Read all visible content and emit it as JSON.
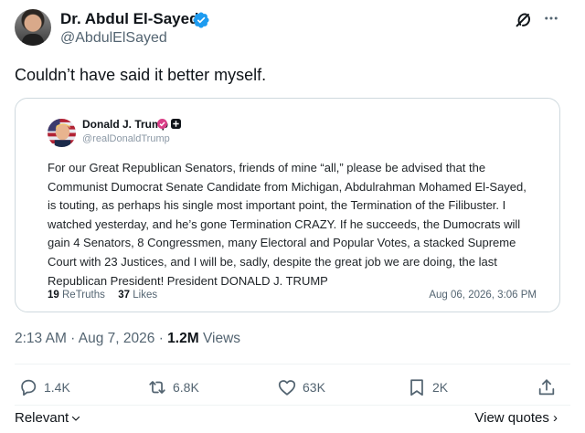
{
  "author": {
    "name": "Dr. Abdul El-Sayed",
    "handle": "@AbdulElSayed"
  },
  "tweet": {
    "text": "Couldn’t have said it better myself."
  },
  "quoted": {
    "name": "Donald J. Trump",
    "handle": "@realDonaldTrump",
    "body": "For our Great Republican Senators, friends of mine “all,” please be advised that the Communist Dumocrat Senate Candidate from Michigan, Abdulrahman Mohamed El-Sayed, is touting, as perhaps his single most important point, the Termination of the Filibuster. I watched yesterday, and he’s gone Termination CRAZY. If he succeeds, the Dumocrats will gain 4 Senators, 8 Congressmen, many Electoral and Popular Votes, a stacked Supreme Court with 23 Justices, and I will be, sadly, despite the great job we are doing, the last Republican President! President DONALD J. TRUMP",
    "retruths_count": "19",
    "retruths_label": "ReTruths",
    "likes_count": "37",
    "likes_label": "Likes",
    "date": "Aug 06, 2026, 3:06 PM"
  },
  "meta": {
    "time": "2:13 AM · Aug 7, 2026 ·",
    "views_count": "1.2M",
    "views_label": "Views"
  },
  "actions": {
    "replies": "1.4K",
    "reposts": "6.8K",
    "likes": "63K",
    "bookmarks": "2K"
  },
  "footer": {
    "sort_label": "Relevant",
    "view_quotes": "View quotes ›"
  },
  "colors": {
    "verified": "#1d9bf0",
    "secondary_text": "#536471",
    "border": "#cfd9de"
  }
}
